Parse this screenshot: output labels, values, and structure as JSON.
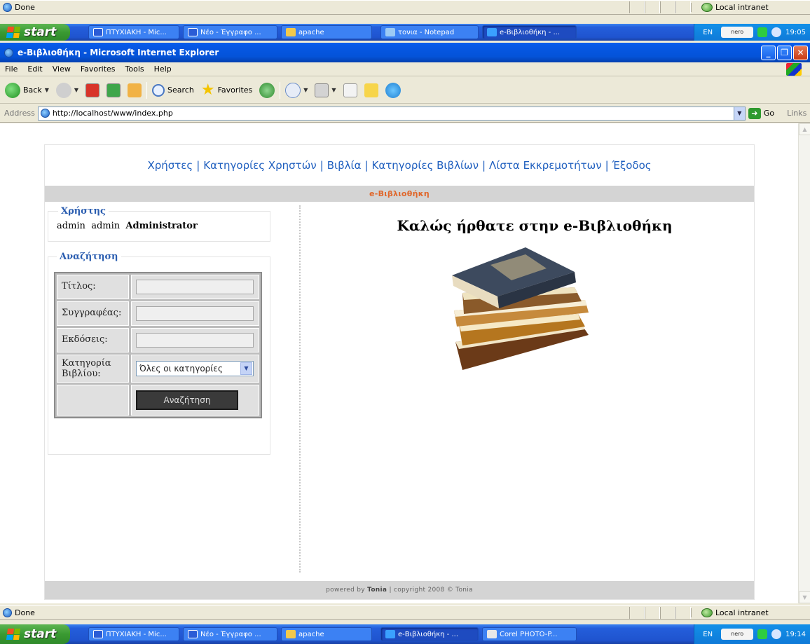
{
  "top_status": {
    "text": "Done",
    "zone": "Local intranet"
  },
  "top_taskbar": {
    "start": "start",
    "tasks": [
      "ΠΤΥΧΙΑΚΗ - Mic...",
      "Νέο - Έγγραφο ...",
      "apache",
      "τονια - Notepad",
      "e-Βιβλιοθήκη - ..."
    ],
    "lang": "EN",
    "nero": "nero",
    "time": "19:05"
  },
  "window": {
    "title": "e-Βιβλιοθήκη - Microsoft Internet Explorer"
  },
  "menu": [
    "File",
    "Edit",
    "View",
    "Favorites",
    "Tools",
    "Help"
  ],
  "toolbar": {
    "back": "Back",
    "search": "Search",
    "favorites": "Favorites"
  },
  "address": {
    "label": "Address",
    "url": "http://localhost/www/index.php",
    "go": "Go",
    "links": "Links"
  },
  "site": {
    "nav": [
      "Χρήστες",
      "Κατηγορίες Χρηστών",
      "Βιβλία",
      "Κατηγορίες Βιβλίων",
      "Λίστα Εκκρεμοτήτων",
      "Έξοδος"
    ],
    "banner": "e-Βιβλιοθήκη",
    "user_legend": "Χρήστης",
    "user_first": "admin",
    "user_last": "admin",
    "user_role": "Administrator",
    "search_legend": "Αναζήτηση",
    "fields": {
      "title": "Τίτλος:",
      "author": "Συγγραφέας:",
      "publisher": "Εκδόσεις:",
      "category": "Κατηγορία Βιβλίου:"
    },
    "category_selected": "Όλες οι κατηγορίες",
    "search_button": "Αναζήτηση",
    "welcome": "Καλώς ήρθατε στην e-Βιβλιοθήκη",
    "footer_pre": "powered by",
    "footer_author": "Tonia",
    "footer_post": "| copyright 2008 © Tonia"
  },
  "bottom_status": {
    "text": "Done",
    "zone": "Local intranet"
  },
  "bottom_taskbar": {
    "start": "start",
    "tasks": [
      "ΠΤΥΧΙΑΚΗ - Mic...",
      "Νέο - Έγγραφο ...",
      "apache",
      "e-Βιβλιοθήκη - ...",
      "Corel PHOTO-P..."
    ],
    "lang": "EN",
    "nero": "nero",
    "time": "19:14"
  }
}
